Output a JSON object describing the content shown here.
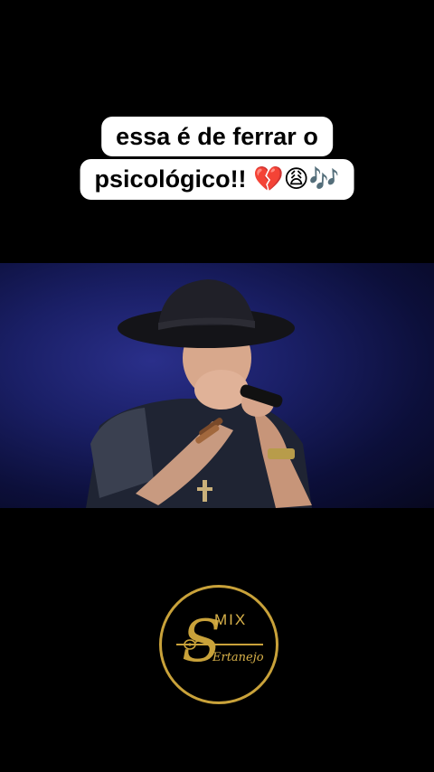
{
  "caption": {
    "line1": "essa é de ferrar o",
    "line2_text": "psicológico!!",
    "line2_emojis": "💔😩🎶"
  },
  "logo": {
    "mix": "MIX",
    "sub": "Ertanejo"
  },
  "colors": {
    "background": "#000000",
    "caption_bg": "#ffffff",
    "logo_gold": "#c9a23a",
    "stage_blue": "#1a1f66"
  }
}
